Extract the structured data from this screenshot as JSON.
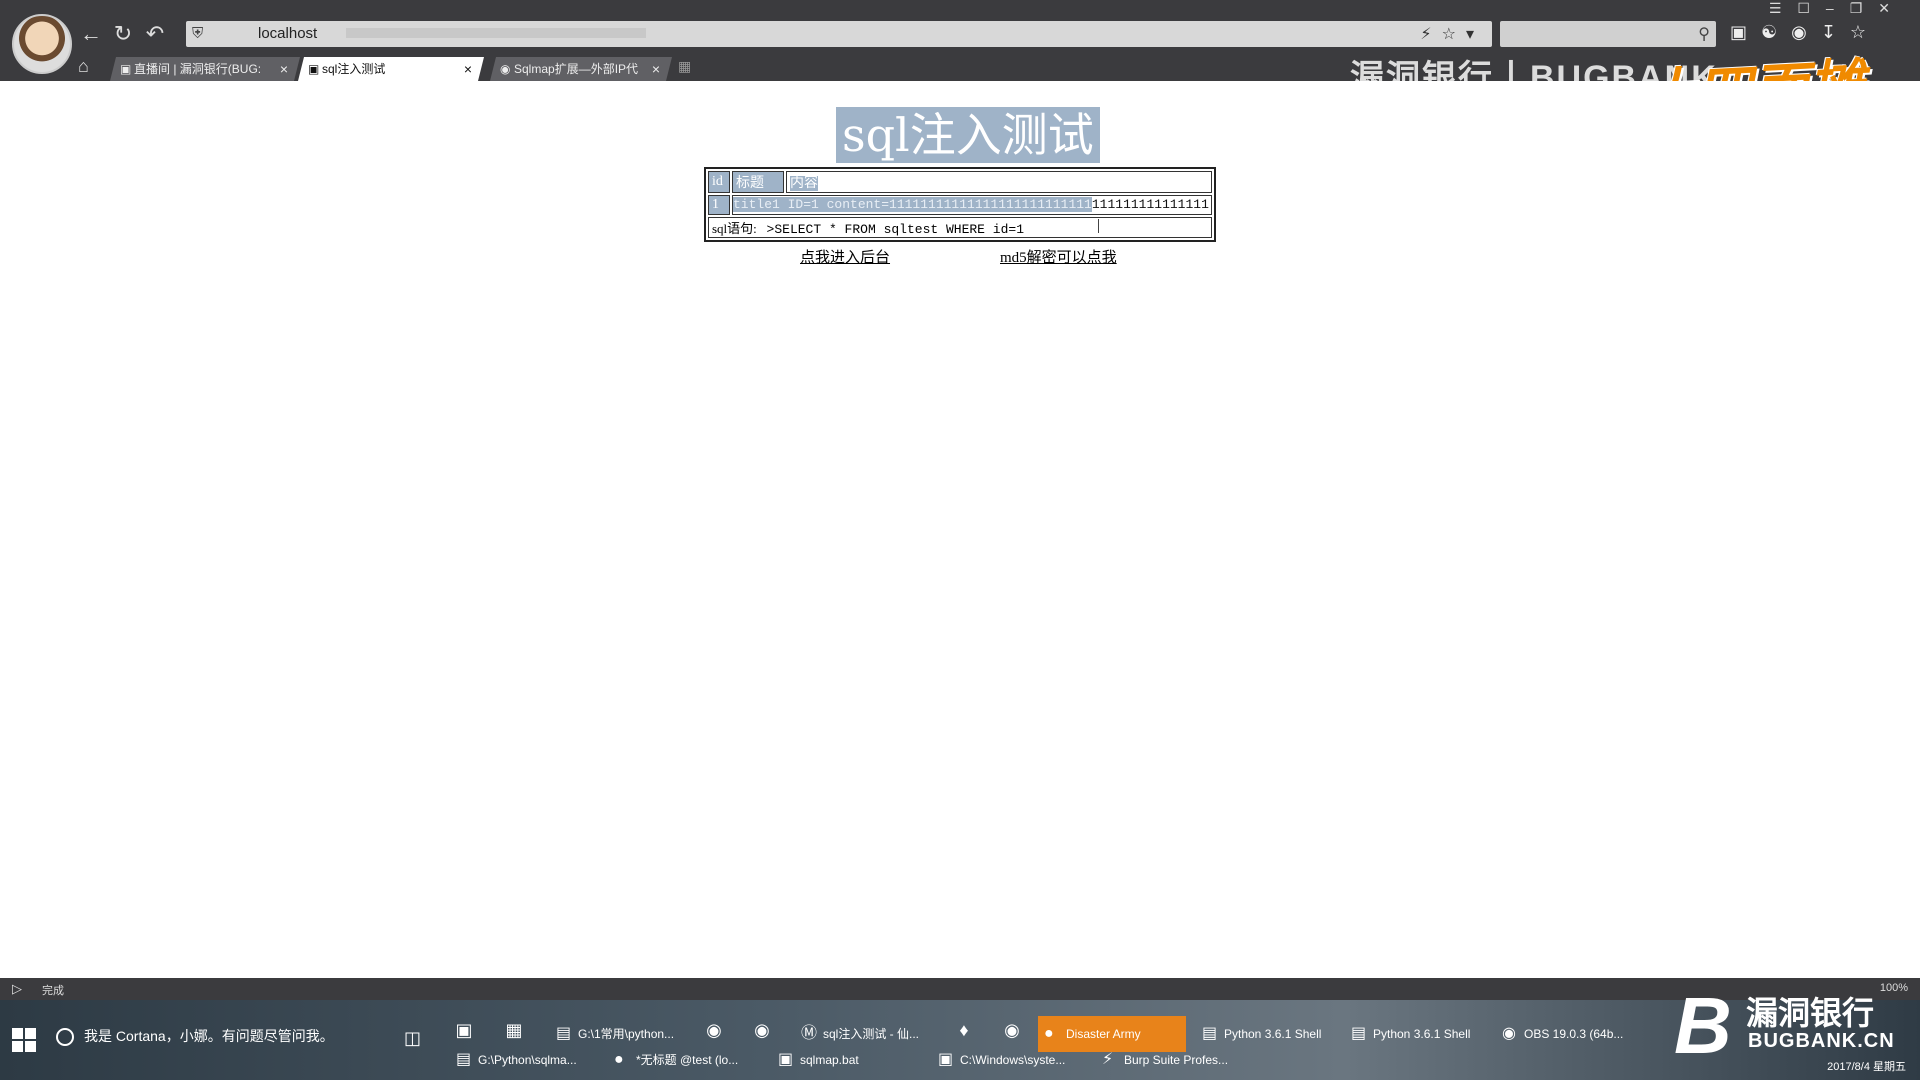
{
  "browser": {
    "url": "localhost",
    "search_placeholder": "",
    "status_text": "完成",
    "zoom": "100%",
    "brand_header": "漏洞银行丨BUGBANK",
    "watermark": "大四面摊",
    "tabs": [
      {
        "label": "直播间 | 漏洞银行(BUG:",
        "active": false
      },
      {
        "label": "sql注入测试",
        "active": true
      },
      {
        "label": "Sqlmap扩展—外部IP代",
        "active": false
      }
    ]
  },
  "page": {
    "title": "sql注入测试",
    "table": {
      "headers": [
        "id",
        "标题",
        "内容"
      ],
      "row": {
        "id": "1",
        "selected_text": "title1 ID=1 content=11111111111111111111111111",
        "unselected_text": "111111111111111"
      },
      "sql_label": "sql语句:",
      "sql_statement": ">SELECT * FROM sqltest WHERE id=1"
    },
    "links": {
      "admin": "点我进入后台",
      "md5": "md5解密可以点我"
    }
  },
  "taskbar": {
    "cortana": "我是 Cortana，小娜。有问题尽管问我。",
    "items_row1": [
      "G:\\1常用\\python...",
      "sql注入测试 - 仙...",
      "Disaster Army",
      "Python 3.6.1 Shell",
      "Python 3.6.1 Shell",
      "OBS 19.0.3 (64b..."
    ],
    "items_row2": [
      "G:\\Python\\sqlma...",
      "*无标题 @test (lo...",
      "sqlmap.bat",
      "C:\\Windows\\syste...",
      "Burp Suite Profes..."
    ],
    "brand_cn": "漏洞银行",
    "brand_en": "BUGBANK.CN",
    "date": "2017/8/4 星期五"
  }
}
